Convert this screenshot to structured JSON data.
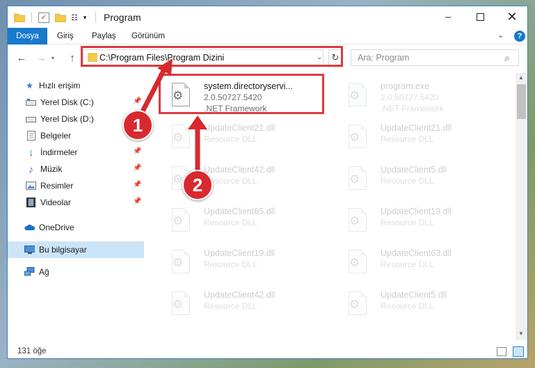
{
  "window": {
    "title": "Program",
    "controls": {
      "minimize": "–",
      "close": "✕"
    }
  },
  "ribbon": {
    "tabs": [
      "Dosya",
      "Giriş",
      "Paylaş",
      "Görünüm"
    ]
  },
  "navigation": {
    "address": "C:\\Program Files\\Program Dizini",
    "search_placeholder": "Ara: Program"
  },
  "sidebar": {
    "items": [
      {
        "label": "Hızlı erişim",
        "icon": "star-icon",
        "pinned": false
      },
      {
        "label": "Yerel Disk (C:)",
        "icon": "drive-icon",
        "pinned": true
      },
      {
        "label": "Yerel Disk (D:)",
        "icon": "drive-icon",
        "pinned": true
      },
      {
        "label": "Belgeler",
        "icon": "documents-icon",
        "pinned": true
      },
      {
        "label": "İndirmeler",
        "icon": "download-icon",
        "pinned": true
      },
      {
        "label": "Müzik",
        "icon": "music-icon",
        "pinned": true
      },
      {
        "label": "Resimler",
        "icon": "pictures-icon",
        "pinned": true
      },
      {
        "label": "Videolar",
        "icon": "video-icon",
        "pinned": true
      },
      {
        "label": "OneDrive",
        "icon": "cloud-icon",
        "pinned": false
      },
      {
        "label": "Bu bilgisayar",
        "icon": "computer-icon",
        "pinned": false,
        "selected": true
      },
      {
        "label": "Ağ",
        "icon": "network-icon",
        "pinned": false
      }
    ]
  },
  "files": [
    {
      "name": "system.directoryservi...",
      "line1": "2.0.50727.5420",
      "line2": ".NET Framework",
      "highlighted": true
    },
    {
      "name": "program.exe",
      "line1": "2.0.50727.5420",
      "line2": ".NET Framework"
    },
    {
      "name": "UpdateClient21.dll",
      "line1": "Resource DLL"
    },
    {
      "name": "UpdateClient21.dll",
      "line1": "Resource DLL"
    },
    {
      "name": "UpdateClient42.dll",
      "line1": "Resource DLL"
    },
    {
      "name": "UpdateClient5.dll",
      "line1": "Resource DLL"
    },
    {
      "name": "UpdateClient65.dll",
      "line1": "Resource DLL"
    },
    {
      "name": "UpdateClient19.dll",
      "line1": "Resource DLL"
    },
    {
      "name": "UpdateClient19.dll",
      "line1": "Resource DLL"
    },
    {
      "name": "UpdateClient63.dll",
      "line1": "Resource DLL"
    },
    {
      "name": "UpdateClient42.dll",
      "line1": "Resource DLL"
    },
    {
      "name": "UpdateClient5.dll",
      "line1": "Resource DLL"
    }
  ],
  "status": {
    "count": "131 öğe"
  },
  "annotations": {
    "callout1": "1",
    "callout2": "2",
    "highlight_color": "#e0393e"
  },
  "colors": {
    "accent": "#1979ca",
    "selection": "#cce4f7"
  }
}
